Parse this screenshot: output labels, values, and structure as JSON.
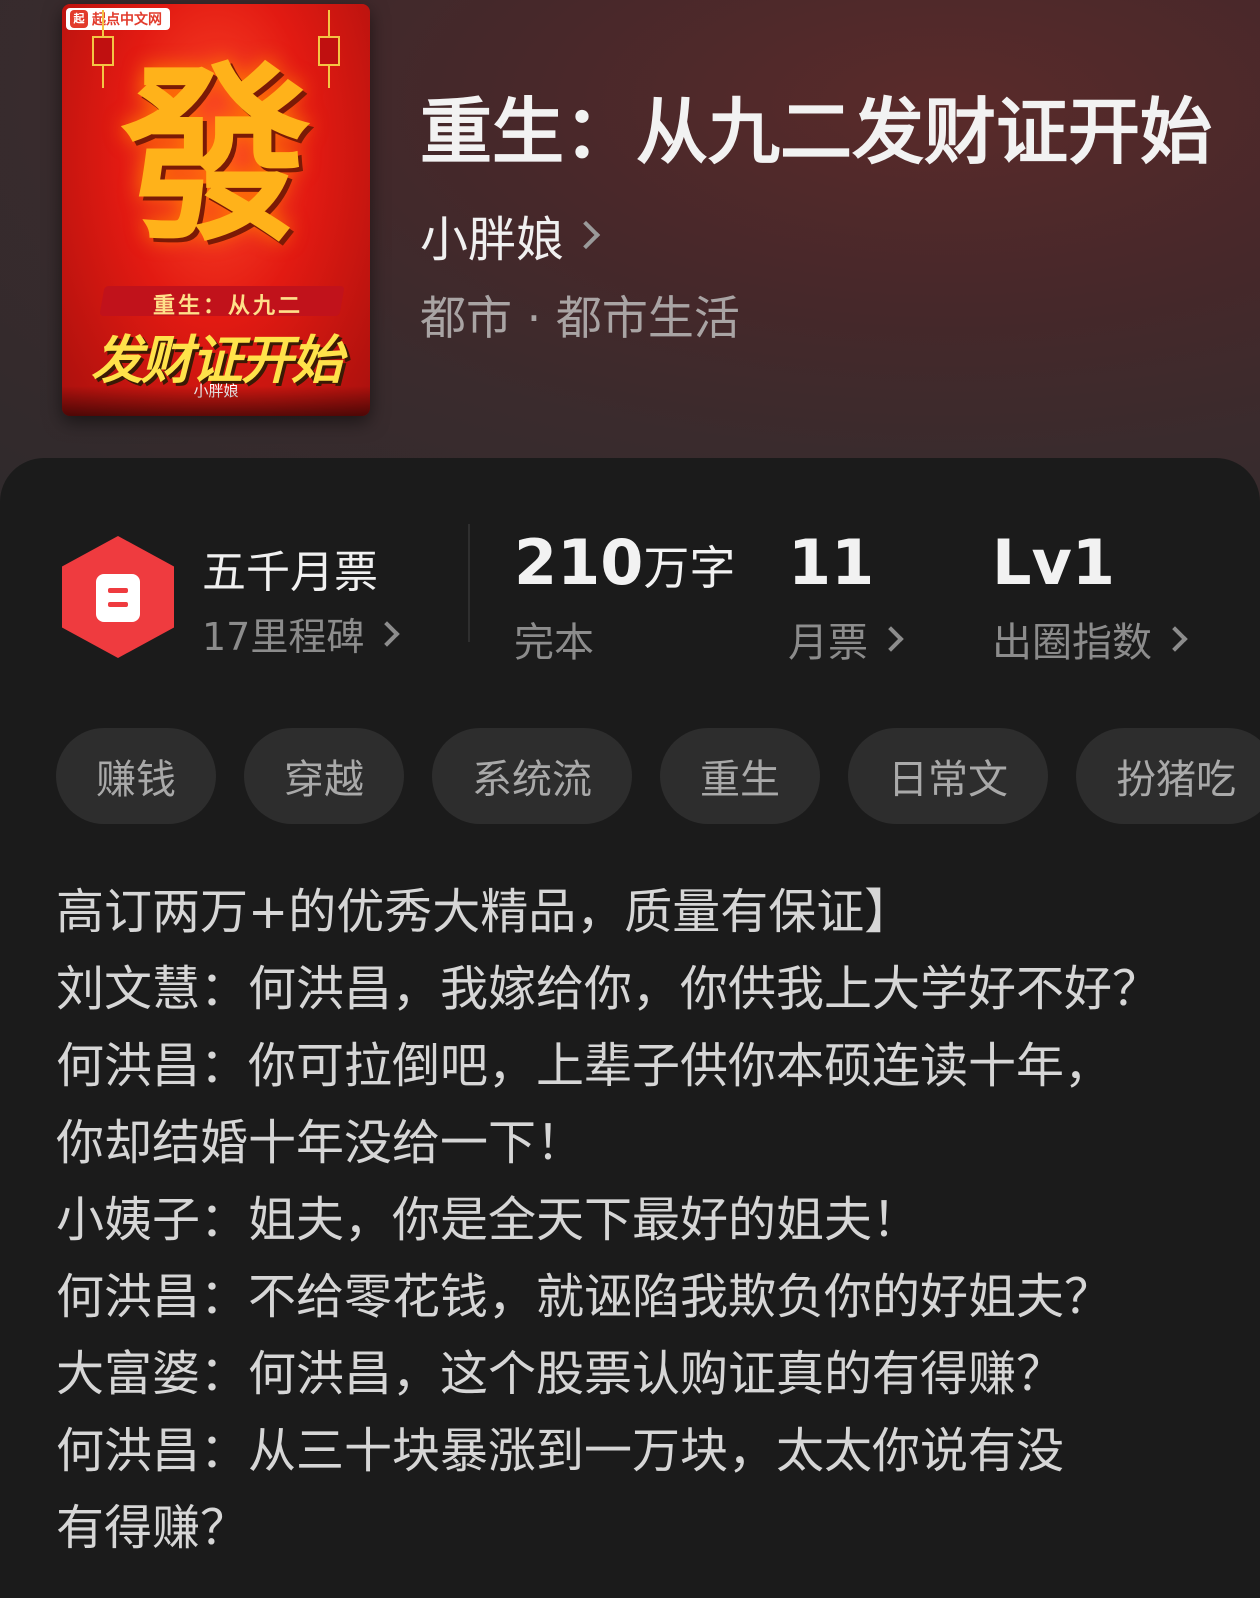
{
  "cover": {
    "logo": "起点中文网",
    "big_char": "發",
    "subtitle": "重生：从九二",
    "title": "发财证开始",
    "author": "小胖娘"
  },
  "book": {
    "title": "重生：从九二发财证开始",
    "author": "小胖娘",
    "category": "都市 · 都市生活"
  },
  "milestone": {
    "title": "五千月票",
    "sub": "17里程碑"
  },
  "stats": {
    "words_value": "210",
    "words_unit": "万字",
    "words_label": "完本",
    "votes_value": "11",
    "votes_label": "月票",
    "level_value": "Lv1",
    "level_label": "出圈指数"
  },
  "tags": [
    "赚钱",
    "穿越",
    "系统流",
    "重生",
    "日常文",
    "扮猪吃"
  ],
  "description": [
    "高订两万+的优秀大精品，质量有保证】",
    "刘文慧：何洪昌，我嫁给你，你供我上大学好不好？",
    "何洪昌：你可拉倒吧，上辈子供你本硕连读十年，",
    "你却结婚十年没给一下！",
    "小姨子：姐夫，你是全天下最好的姐夫！",
    "何洪昌：不给零花钱，就诬陷我欺负你的好姐夫？",
    "大富婆：何洪昌，这个股票认购证真的有得赚？",
    "何洪昌：从三十块暴涨到一万块，太太你说有没",
    "有得赚？"
  ],
  "colors": {
    "accent": "#ef3b3f",
    "panel": "#1b1b1b",
    "tag_bg": "#2d2d2d"
  }
}
